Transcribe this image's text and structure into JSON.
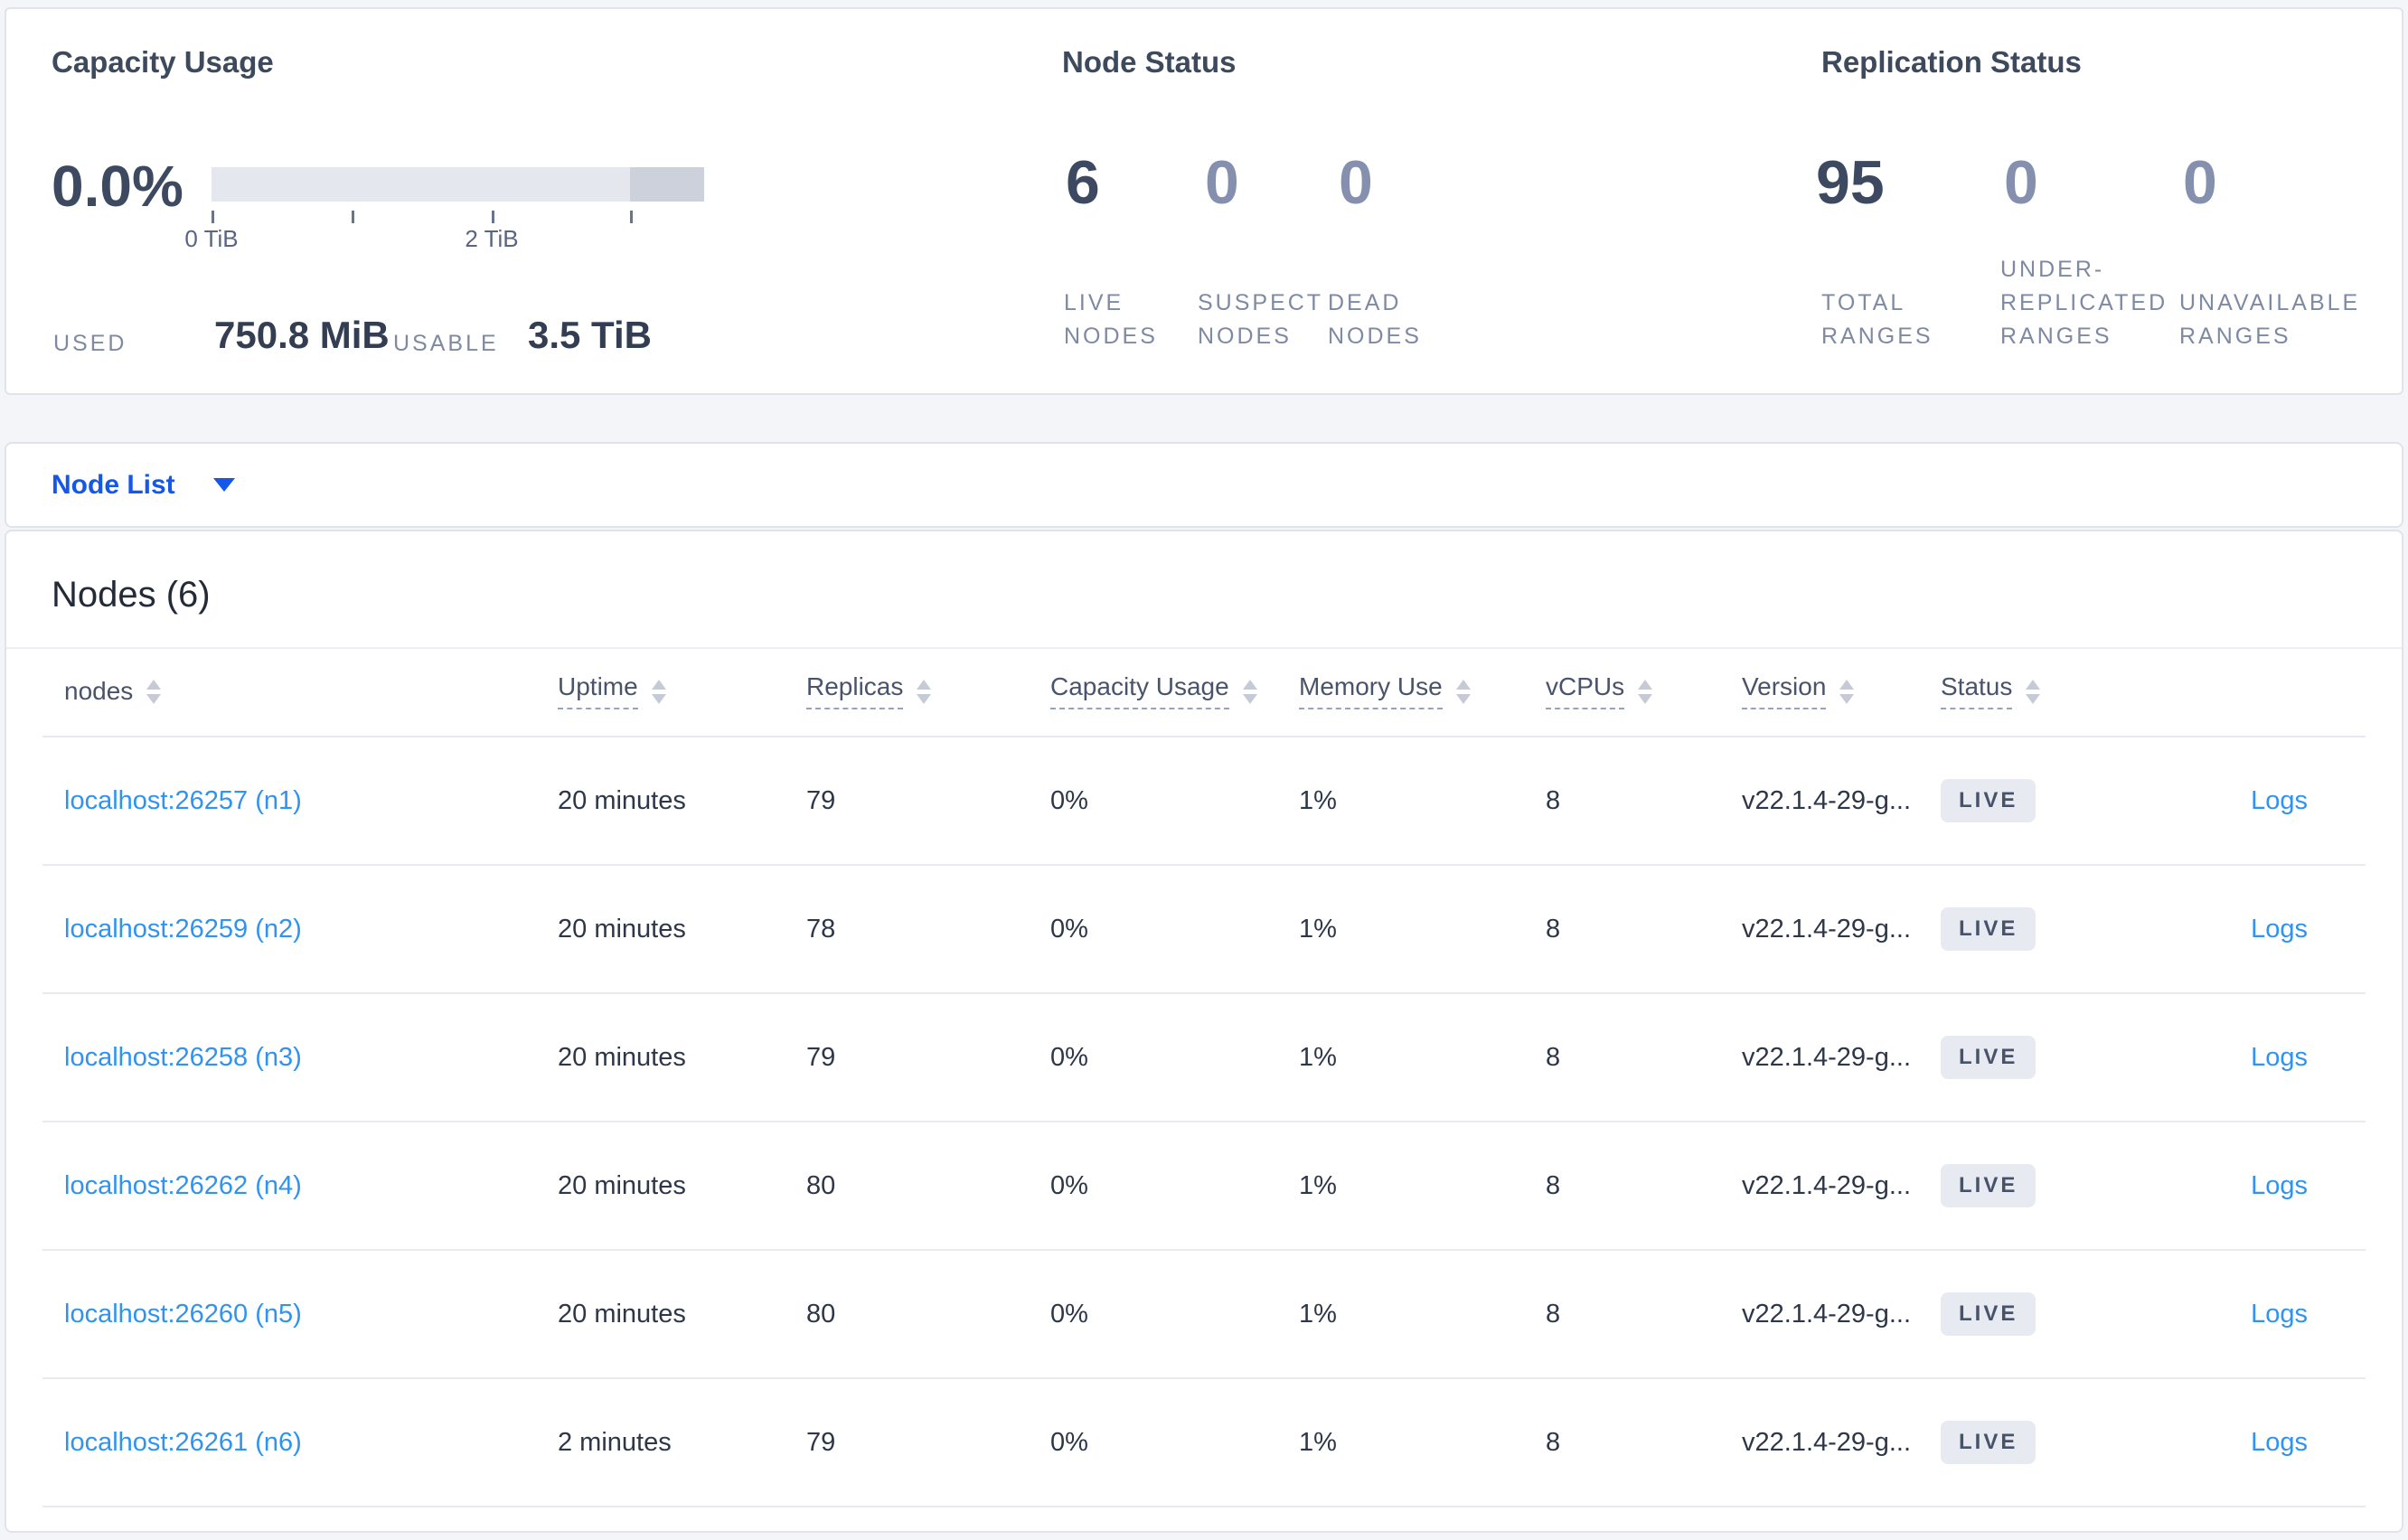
{
  "capacity": {
    "title": "Capacity Usage",
    "percent": "0.0%",
    "tick_label_0": "0 TiB",
    "tick_label_2": "2 TiB",
    "used_label": "USED",
    "used_value": "750.8 MiB",
    "usable_label": "USABLE",
    "usable_value": "3.5 TiB"
  },
  "node_status": {
    "title": "Node Status",
    "stats": [
      {
        "value": "6",
        "label": "LIVE\nNODES"
      },
      {
        "value": "0",
        "label": "SUSPECT\nNODES"
      },
      {
        "value": "0",
        "label": "DEAD\nNODES"
      }
    ]
  },
  "replication_status": {
    "title": "Replication Status",
    "stats": [
      {
        "value": "95",
        "label": "TOTAL\nRANGES"
      },
      {
        "value": "0",
        "label": "UNDER-\nREPLICATED\nRANGES"
      },
      {
        "value": "0",
        "label": "UNAVAILABLE\nRANGES"
      }
    ]
  },
  "node_list": {
    "label": "Node List"
  },
  "table": {
    "title": "Nodes (6)",
    "headers": [
      "nodes",
      "Uptime",
      "Replicas",
      "Capacity Usage",
      "Memory Use",
      "vCPUs",
      "Version",
      "Status"
    ],
    "rows": [
      {
        "node": "localhost:26257 (n1)",
        "uptime": "20 minutes",
        "replicas": "79",
        "capacity": "0%",
        "memory": "1%",
        "vcpus": "8",
        "version": "v22.1.4-29-g...",
        "status": "LIVE",
        "logs": "Logs"
      },
      {
        "node": "localhost:26259 (n2)",
        "uptime": "20 minutes",
        "replicas": "78",
        "capacity": "0%",
        "memory": "1%",
        "vcpus": "8",
        "version": "v22.1.4-29-g...",
        "status": "LIVE",
        "logs": "Logs"
      },
      {
        "node": "localhost:26258 (n3)",
        "uptime": "20 minutes",
        "replicas": "79",
        "capacity": "0%",
        "memory": "1%",
        "vcpus": "8",
        "version": "v22.1.4-29-g...",
        "status": "LIVE",
        "logs": "Logs"
      },
      {
        "node": "localhost:26262 (n4)",
        "uptime": "20 minutes",
        "replicas": "80",
        "capacity": "0%",
        "memory": "1%",
        "vcpus": "8",
        "version": "v22.1.4-29-g...",
        "status": "LIVE",
        "logs": "Logs"
      },
      {
        "node": "localhost:26260 (n5)",
        "uptime": "20 minutes",
        "replicas": "80",
        "capacity": "0%",
        "memory": "1%",
        "vcpus": "8",
        "version": "v22.1.4-29-g...",
        "status": "LIVE",
        "logs": "Logs"
      },
      {
        "node": "localhost:26261 (n6)",
        "uptime": "2 minutes",
        "replicas": "79",
        "capacity": "0%",
        "memory": "1%",
        "vcpus": "8",
        "version": "v22.1.4-29-g...",
        "status": "LIVE",
        "logs": "Logs"
      }
    ]
  },
  "colors": {
    "page_background": "#f4f5f9",
    "panel_border": "#e0e3ea",
    "primary_link_blue": "#1557e8",
    "table_link_blue": "#2f93f2",
    "stat_dark": "#3d4961",
    "stat_dim": "#8490ae",
    "badge_background": "#e7eaf1",
    "bar_light": "#e4e7ed",
    "bar_dark": "#ccd1db"
  }
}
